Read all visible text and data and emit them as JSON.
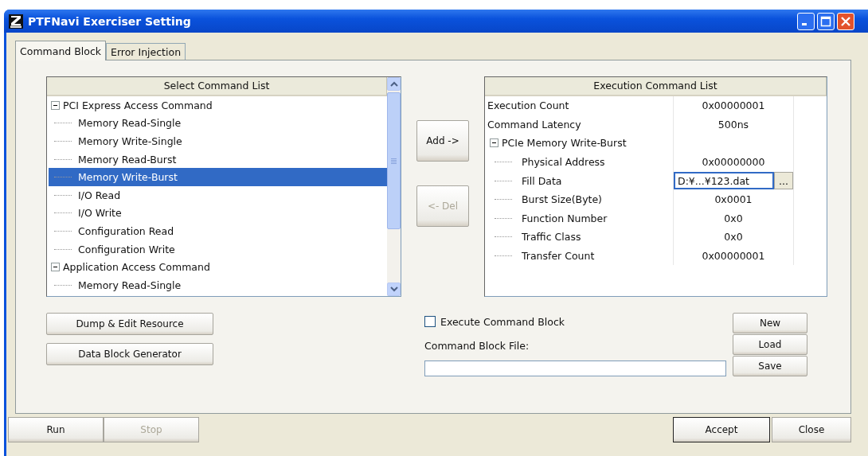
{
  "window": {
    "title": "PTFNavi Exerciser Setting"
  },
  "tabs": [
    {
      "label": "Command Block",
      "selected": true
    },
    {
      "label": "Error Injection",
      "selected": false
    }
  ],
  "select_list": {
    "header": "Select Command List",
    "groups": [
      {
        "label": "PCI Express Access Command",
        "expanded": true,
        "children": [
          {
            "label": "Memory Read-Single",
            "selected": false
          },
          {
            "label": "Memory Write-Single",
            "selected": false
          },
          {
            "label": "Memory Read-Burst",
            "selected": false
          },
          {
            "label": "Memory Write-Burst",
            "selected": true
          },
          {
            "label": "I/O Read",
            "selected": false
          },
          {
            "label": "I/O Write",
            "selected": false
          },
          {
            "label": "Configuration Read",
            "selected": false
          },
          {
            "label": "Configuration Write",
            "selected": false
          }
        ]
      },
      {
        "label": "Application Access Command",
        "expanded": true,
        "children": [
          {
            "label": "Memory Read-Single",
            "selected": false
          }
        ]
      }
    ]
  },
  "move_buttons": [
    {
      "label": "Add ->",
      "disabled": false
    },
    {
      "label": "<- Del",
      "disabled": true
    }
  ],
  "execution_list": {
    "header": "Execution Command List",
    "rows": [
      {
        "name": "Execution Count",
        "value": "0x00000001"
      },
      {
        "name": "Command Latency",
        "value": "500ns"
      }
    ],
    "groups": [
      {
        "label": "PCIe Memory Write-Burst",
        "expanded": true,
        "children": [
          {
            "kind": "text",
            "name": "Physical Address",
            "value": "0x00000000"
          },
          {
            "kind": "file",
            "name": "Fill Data",
            "value": "D:¥...¥123.dat",
            "browse": "..."
          },
          {
            "kind": "text",
            "name": "Burst Size(Byte)",
            "value": "0x0001"
          },
          {
            "kind": "text",
            "name": "Function Number",
            "value": "0x0"
          },
          {
            "kind": "text",
            "name": "Traffic Class",
            "value": "0x0"
          },
          {
            "kind": "text",
            "name": "Transfer Count",
            "value": "0x00000001"
          }
        ]
      }
    ]
  },
  "left_buttons": [
    {
      "label": "Dump & Edit Resource"
    },
    {
      "label": "Data Block Generator"
    }
  ],
  "execute_checkbox": {
    "label": "Execute Command Block",
    "checked": false
  },
  "file_field": {
    "label": "Command Block File:"
  },
  "file_buttons": [
    {
      "label": "New"
    },
    {
      "label": "Load"
    },
    {
      "label": "Save"
    }
  ],
  "footer_left": [
    {
      "label": "Run",
      "disabled": false
    },
    {
      "label": "Stop",
      "disabled": true
    }
  ],
  "footer_right": [
    {
      "label": "Accept",
      "default": true
    },
    {
      "label": "Close",
      "default": false
    }
  ]
}
